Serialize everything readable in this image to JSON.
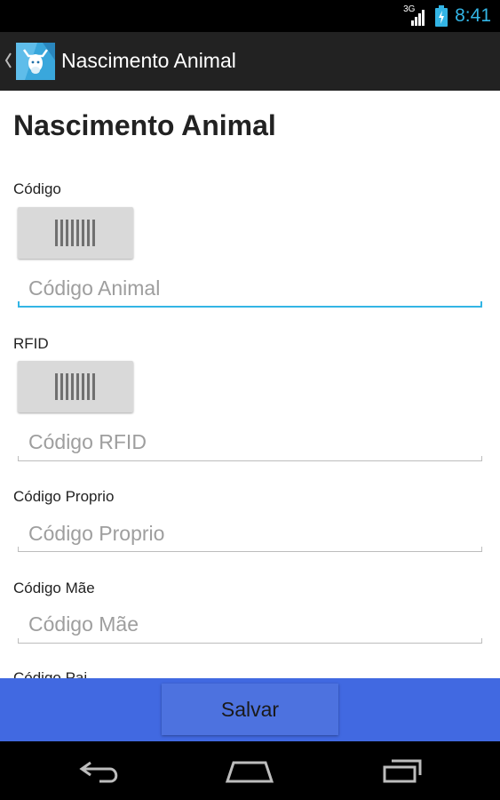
{
  "status_bar": {
    "network_type": "3G",
    "time": "8:41",
    "icons": [
      "signal-icon",
      "battery-charging-icon"
    ]
  },
  "action_bar": {
    "title": "Nascimento Animal",
    "icons": [
      "up-caret-icon",
      "app-logo-icon"
    ]
  },
  "page": {
    "title": "Nascimento Animal"
  },
  "form": {
    "codigo": {
      "label": "Código",
      "placeholder": "Código Animal",
      "scan_icon": "barcode-icon"
    },
    "rfid": {
      "label": "RFID",
      "placeholder": "Código RFID",
      "scan_icon": "barcode-icon"
    },
    "codigo_proprio": {
      "label": "Código Proprio",
      "placeholder": "Código Proprio"
    },
    "codigo_mae": {
      "label": "Código Mãe",
      "placeholder": "Código Mãe"
    },
    "codigo_pai": {
      "label": "Código Pai"
    }
  },
  "footer": {
    "save_label": "Salvar"
  },
  "navigation": {
    "icons": [
      "back-icon",
      "home-icon",
      "recent-apps-icon"
    ]
  },
  "colors": {
    "accent": "#33b5e5",
    "action_bar": "#222222",
    "bottom_bar": "#4169e1",
    "save_button": "#4d72df"
  }
}
